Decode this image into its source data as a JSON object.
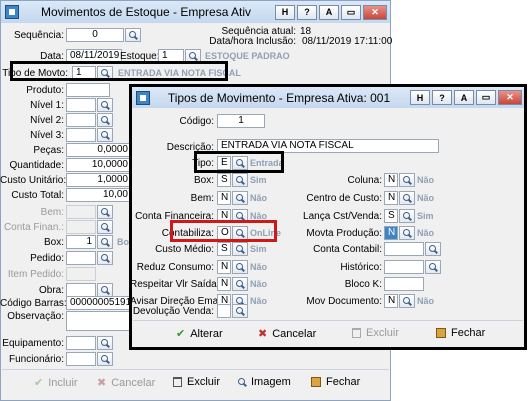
{
  "main": {
    "title": "Movimentos de Estoque - Empresa Ativ",
    "tb_h": "H",
    "tb_q": "?",
    "tb_a": "A",
    "tb_min": "▭",
    "tb_close": "✕",
    "seq_label": "Sequência:",
    "seq_value": "0",
    "seq_atual_label": "Sequência atual:",
    "seq_atual_value": "18",
    "data_hora_label": "Data/hora Inclusão:",
    "data_hora_value": "08/11/2019 17:11:00",
    "data_label": "Data:",
    "data_value": "08/11/2019",
    "estoque_label": "Estoque:",
    "estoque_value": "1",
    "estoque_desc": "ESTOQUE PADRAO",
    "tipo_label": "Tipo de Movto:",
    "tipo_value": "1",
    "tipo_desc": "ENTRADA VIA NOTA FISCAL",
    "produto_label": "Produto:",
    "nivel1": "Nível 1:",
    "nivel2": "Nível 2:",
    "nivel3": "Nível 3:",
    "pecas_label": "Peças:",
    "pecas_value": "0,0000",
    "quantidade_label": "Quantidade:",
    "quantidade_value": "10,0000",
    "custo_unit_label": "Custo Unitário:",
    "custo_unit_value": "1,0000",
    "custo_total_label": "Custo Total:",
    "custo_total_value": "10,00",
    "bem_label": "Bem:",
    "conta_finan_label": "Conta Finan.:",
    "box_label": "Box:",
    "box_value": "1",
    "box_desc": "Bo",
    "pedido_label": "Pedido:",
    "item_pedido_label": "Item Pedido:",
    "obra_label": "Obra:",
    "codigo_barras_label": "Código Barras:",
    "codigo_barras_value": "000000051911081",
    "observacao_label": "Observação:",
    "equipamento_label": "Equipamento:",
    "funcionario_label": "Funcionário:",
    "btn_incluir": "Incluir",
    "btn_cancelar": "Cancelar",
    "btn_excluir": "Excluir",
    "btn_imagem": "Imagem",
    "btn_fechar": "Fechar"
  },
  "dialog": {
    "title": "Tipos de Movimento - Empresa Ativa: 001",
    "tb_h": "H",
    "tb_q": "?",
    "tb_a": "A",
    "tb_min": "▭",
    "tb_close": "✕",
    "codigo_label": "Código:",
    "codigo_value": "1",
    "descricao_label": "Descrição:",
    "descricao_value": "ENTRADA VIA NOTA FISCAL",
    "tipo_label": "Tipo:",
    "tipo_value": "E",
    "tipo_desc": "Entrada",
    "left": [
      {
        "label": "Box:",
        "value": "S",
        "desc": "Sim"
      },
      {
        "label": "Bem:",
        "value": "N",
        "desc": "Não"
      },
      {
        "label": "Conta Financeira:",
        "value": "N",
        "desc": "Não"
      },
      {
        "label": "Contabiliza:",
        "value": "O",
        "desc": "OnLine"
      },
      {
        "label": "Custo Médio:",
        "value": "S",
        "desc": "Sim"
      },
      {
        "label": "Reduz Consumo:",
        "value": "N",
        "desc": "Não"
      },
      {
        "label": "Respeitar Vlr Saída:",
        "value": "N",
        "desc": "Não"
      },
      {
        "label": "Avisar Direção Email:",
        "value": "N",
        "desc": "Não"
      },
      {
        "label": "Devolução Venda:",
        "value": "",
        "desc": ""
      }
    ],
    "right": [
      {
        "label": "Coluna:",
        "value": "N",
        "desc": "Não"
      },
      {
        "label": "Centro de Custo:",
        "value": "N",
        "desc": "Não"
      },
      {
        "label": "Lança Cst/Venda:",
        "value": "S",
        "desc": "Sim"
      },
      {
        "label": "Movta Produção:",
        "value": "N",
        "desc": "Não"
      },
      {
        "label": "Conta Contabil:",
        "value": "",
        "desc": ""
      },
      {
        "label": "Histórico:",
        "value": "",
        "desc": ""
      },
      {
        "label": "Bloco K:",
        "value": "",
        "desc": ""
      },
      {
        "label": "Mov Documento:",
        "value": "N",
        "desc": "Não"
      }
    ],
    "btn_alterar": "Alterar",
    "btn_cancelar": "Cancelar",
    "btn_excluir": "Excluir",
    "btn_fechar": "Fechar"
  }
}
